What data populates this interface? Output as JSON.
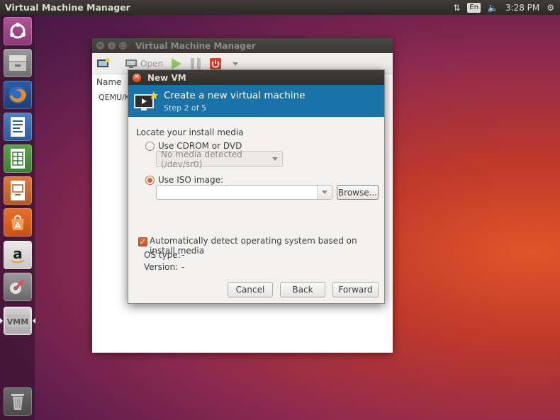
{
  "top_panel": {
    "title": "Virtual Machine Manager",
    "lang": "En",
    "time": "3:28 PM"
  },
  "launcher": {
    "items": [
      "ubuntu-dash",
      "files",
      "firefox",
      "libreoffice-writer",
      "libreoffice-calc",
      "libreoffice-impress",
      "ubuntu-software",
      "amazon",
      "system-settings",
      "virtual-machine-manager",
      "trash"
    ]
  },
  "bg_window": {
    "title": "Virtual Machine Manager",
    "toolbar_open": "Open",
    "list_header": "Name",
    "list_row": "QEMU/KV"
  },
  "dialog": {
    "title": "New VM",
    "header_title": "Create a new virtual machine",
    "header_step": "Step 2 of 5",
    "section_label": "Locate your install media",
    "option_cdrom": "Use CDROM or DVD",
    "cdrom_combo": "No media detected (/dev/sr0)",
    "option_iso": "Use ISO image:",
    "iso_path": "",
    "browse": "Browse...",
    "auto_detect": "Automatically detect operating system based on install media",
    "os_type_label": "OS type:",
    "os_type_value": "-",
    "version_label": "Version:",
    "version_value": "-",
    "cancel": "Cancel",
    "back": "Back",
    "forward": "Forward"
  },
  "colors": {
    "header_blue": "#1a73a8",
    "accent_orange": "#e0622a"
  }
}
